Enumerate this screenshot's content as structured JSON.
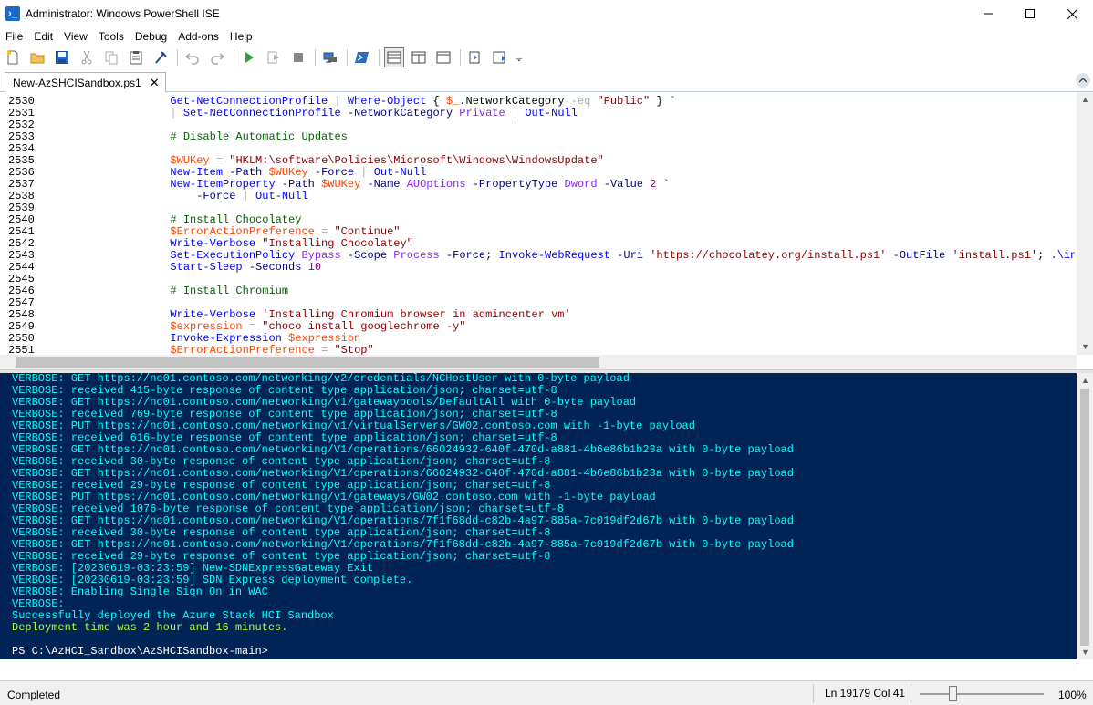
{
  "window": {
    "title": "Administrator: Windows PowerShell ISE",
    "icon_label": "›_"
  },
  "menu": [
    "File",
    "Edit",
    "View",
    "Tools",
    "Debug",
    "Add-ons",
    "Help"
  ],
  "toolbar_icons": [
    "new-icon",
    "open-icon",
    "save-icon",
    "cut-icon",
    "copy-icon",
    "paste-icon",
    "clear-console-icon",
    "undo-icon",
    "redo-icon",
    "run-script-icon",
    "run-selection-icon",
    "stop-icon",
    "remote-powershell-icon",
    "powershell-icon",
    "show-script-pane-top-icon",
    "show-script-pane-right-icon",
    "show-script-pane-maximized-icon",
    "show-script-pane-icon",
    "show-command-window-icon",
    "customize-icon"
  ],
  "tab": {
    "title": "New-AzSHCISandbox.ps1",
    "close": "✕"
  },
  "editor": {
    "line_numbers": [
      "2530",
      "2531",
      "2532",
      "2533",
      "2534",
      "2535",
      "2536",
      "2537",
      "2538",
      "2539",
      "2540",
      "2541",
      "2542",
      "2543",
      "2544",
      "2545",
      "2546",
      "2547",
      "2548",
      "2549",
      "2550",
      "2551"
    ],
    "lines": [
      [
        {
          "t": "            "
        },
        {
          "t": "Get-NetConnectionProfile",
          "c": "cmd"
        },
        {
          "t": " "
        },
        {
          "t": "|",
          "c": "op"
        },
        {
          "t": " "
        },
        {
          "t": "Where-Object",
          "c": "cmd"
        },
        {
          "t": " { "
        },
        {
          "t": "$_",
          "c": "var"
        },
        {
          "t": ".NetworkCategory "
        },
        {
          "t": "-eq",
          "c": "op"
        },
        {
          "t": " "
        },
        {
          "t": "\"Public\"",
          "c": "str"
        },
        {
          "t": " } `"
        }
      ],
      [
        {
          "t": "            "
        },
        {
          "t": "|",
          "c": "op"
        },
        {
          "t": " "
        },
        {
          "t": "Set-NetConnectionProfile",
          "c": "cmd"
        },
        {
          "t": " "
        },
        {
          "t": "-NetworkCategory",
          "c": "param"
        },
        {
          "t": " "
        },
        {
          "t": "Private",
          "c": "type"
        },
        {
          "t": " "
        },
        {
          "t": "|",
          "c": "op"
        },
        {
          "t": " "
        },
        {
          "t": "Out-Null",
          "c": "cmd"
        }
      ],
      [
        {
          "t": ""
        }
      ],
      [
        {
          "t": "            "
        },
        {
          "t": "# Disable Automatic Updates",
          "c": "com"
        }
      ],
      [
        {
          "t": ""
        }
      ],
      [
        {
          "t": "            "
        },
        {
          "t": "$WUKey",
          "c": "var"
        },
        {
          "t": " "
        },
        {
          "t": "=",
          "c": "op"
        },
        {
          "t": " "
        },
        {
          "t": "\"HKLM:\\software\\Policies\\Microsoft\\Windows\\WindowsUpdate\"",
          "c": "str"
        }
      ],
      [
        {
          "t": "            "
        },
        {
          "t": "New-Item",
          "c": "cmd"
        },
        {
          "t": " "
        },
        {
          "t": "-Path",
          "c": "param"
        },
        {
          "t": " "
        },
        {
          "t": "$WUKey",
          "c": "var"
        },
        {
          "t": " "
        },
        {
          "t": "-Force",
          "c": "param"
        },
        {
          "t": " "
        },
        {
          "t": "|",
          "c": "op"
        },
        {
          "t": " "
        },
        {
          "t": "Out-Null",
          "c": "cmd"
        }
      ],
      [
        {
          "t": "            "
        },
        {
          "t": "New-ItemProperty",
          "c": "cmd"
        },
        {
          "t": " "
        },
        {
          "t": "-Path",
          "c": "param"
        },
        {
          "t": " "
        },
        {
          "t": "$WUKey",
          "c": "var"
        },
        {
          "t": " "
        },
        {
          "t": "-Name",
          "c": "param"
        },
        {
          "t": " "
        },
        {
          "t": "AUOptions",
          "c": "type"
        },
        {
          "t": " "
        },
        {
          "t": "-PropertyType",
          "c": "param"
        },
        {
          "t": " "
        },
        {
          "t": "Dword",
          "c": "type"
        },
        {
          "t": " "
        },
        {
          "t": "-Value",
          "c": "param"
        },
        {
          "t": " "
        },
        {
          "t": "2",
          "c": "num"
        },
        {
          "t": " `"
        }
      ],
      [
        {
          "t": "                "
        },
        {
          "t": "-Force",
          "c": "param"
        },
        {
          "t": " "
        },
        {
          "t": "|",
          "c": "op"
        },
        {
          "t": " "
        },
        {
          "t": "Out-Null",
          "c": "cmd"
        }
      ],
      [
        {
          "t": ""
        }
      ],
      [
        {
          "t": "            "
        },
        {
          "t": "# Install Chocolatey",
          "c": "com"
        }
      ],
      [
        {
          "t": "            "
        },
        {
          "t": "$ErrorActionPreference",
          "c": "var"
        },
        {
          "t": " "
        },
        {
          "t": "=",
          "c": "op"
        },
        {
          "t": " "
        },
        {
          "t": "\"Continue\"",
          "c": "str"
        }
      ],
      [
        {
          "t": "            "
        },
        {
          "t": "Write-Verbose",
          "c": "cmd"
        },
        {
          "t": " "
        },
        {
          "t": "\"Installing Chocolatey\"",
          "c": "str"
        }
      ],
      [
        {
          "t": "            "
        },
        {
          "t": "Set-ExecutionPolicy",
          "c": "cmd"
        },
        {
          "t": " "
        },
        {
          "t": "Bypass",
          "c": "type"
        },
        {
          "t": " "
        },
        {
          "t": "-Scope",
          "c": "param"
        },
        {
          "t": " "
        },
        {
          "t": "Process",
          "c": "type"
        },
        {
          "t": " "
        },
        {
          "t": "-Force",
          "c": "param"
        },
        {
          "t": "; "
        },
        {
          "t": "Invoke-WebRequest",
          "c": "cmd"
        },
        {
          "t": " "
        },
        {
          "t": "-Uri",
          "c": "param"
        },
        {
          "t": " "
        },
        {
          "t": "'https://chocolatey.org/install.ps1'",
          "c": "str"
        },
        {
          "t": " "
        },
        {
          "t": "-OutFile",
          "c": "param"
        },
        {
          "t": " "
        },
        {
          "t": "'install.ps1'",
          "c": "str"
        },
        {
          "t": "; "
        },
        {
          "t": ".\\install",
          "c": "cmd"
        }
      ],
      [
        {
          "t": "            "
        },
        {
          "t": "Start-Sleep",
          "c": "cmd"
        },
        {
          "t": " "
        },
        {
          "t": "-Seconds",
          "c": "param"
        },
        {
          "t": " "
        },
        {
          "t": "10",
          "c": "num"
        }
      ],
      [
        {
          "t": ""
        }
      ],
      [
        {
          "t": "            "
        },
        {
          "t": "# Install Chromium",
          "c": "com"
        }
      ],
      [
        {
          "t": ""
        }
      ],
      [
        {
          "t": "            "
        },
        {
          "t": "Write-Verbose",
          "c": "cmd"
        },
        {
          "t": " "
        },
        {
          "t": "'Installing Chromium browser in admincenter vm'",
          "c": "str"
        }
      ],
      [
        {
          "t": "            "
        },
        {
          "t": "$expression",
          "c": "var"
        },
        {
          "t": " "
        },
        {
          "t": "=",
          "c": "op"
        },
        {
          "t": " "
        },
        {
          "t": "\"choco install googlechrome -y\"",
          "c": "str"
        }
      ],
      [
        {
          "t": "            "
        },
        {
          "t": "Invoke-Expression",
          "c": "cmd"
        },
        {
          "t": " "
        },
        {
          "t": "$expression",
          "c": "var"
        }
      ],
      [
        {
          "t": "            "
        },
        {
          "t": "$ErrorActionPreference",
          "c": "var"
        },
        {
          "t": " "
        },
        {
          "t": "=",
          "c": "op"
        },
        {
          "t": " "
        },
        {
          "t": "\"Stop\"",
          "c": "str"
        }
      ]
    ]
  },
  "console": {
    "lines": [
      {
        "text": "VERBOSE: GET https://nc01.contoso.com/networking/v2/credentials/NCHostUser with 0-byte payload",
        "color": "#00ffff"
      },
      {
        "text": "VERBOSE: received 415-byte response of content type application/json; charset=utf-8",
        "color": "#00ffff"
      },
      {
        "text": "VERBOSE: GET https://nc01.contoso.com/networking/v1/gatewaypools/DefaultAll with 0-byte payload",
        "color": "#00ffff"
      },
      {
        "text": "VERBOSE: received 769-byte response of content type application/json; charset=utf-8",
        "color": "#00ffff"
      },
      {
        "text": "VERBOSE: PUT https://nc01.contoso.com/networking/v1/virtualServers/GW02.contoso.com with -1-byte payload",
        "color": "#00ffff"
      },
      {
        "text": "VERBOSE: received 616-byte response of content type application/json; charset=utf-8",
        "color": "#00ffff"
      },
      {
        "text": "VERBOSE: GET https://nc01.contoso.com/networking/V1/operations/66024932-640f-470d-a881-4b6e86b1b23a with 0-byte payload",
        "color": "#00ffff"
      },
      {
        "text": "VERBOSE: received 30-byte response of content type application/json; charset=utf-8",
        "color": "#00ffff"
      },
      {
        "text": "VERBOSE: GET https://nc01.contoso.com/networking/V1/operations/66024932-640f-470d-a881-4b6e86b1b23a with 0-byte payload",
        "color": "#00ffff"
      },
      {
        "text": "VERBOSE: received 29-byte response of content type application/json; charset=utf-8",
        "color": "#00ffff"
      },
      {
        "text": "VERBOSE: PUT https://nc01.contoso.com/networking/v1/gateways/GW02.contoso.com with -1-byte payload",
        "color": "#00ffff"
      },
      {
        "text": "VERBOSE: received 1076-byte response of content type application/json; charset=utf-8",
        "color": "#00ffff"
      },
      {
        "text": "VERBOSE: GET https://nc01.contoso.com/networking/V1/operations/7f1f68dd-c82b-4a97-885a-7c019df2d67b with 0-byte payload",
        "color": "#00ffff"
      },
      {
        "text": "VERBOSE: received 30-byte response of content type application/json; charset=utf-8",
        "color": "#00ffff"
      },
      {
        "text": "VERBOSE: GET https://nc01.contoso.com/networking/V1/operations/7f1f68dd-c82b-4a97-885a-7c019df2d67b with 0-byte payload",
        "color": "#00ffff"
      },
      {
        "text": "VERBOSE: received 29-byte response of content type application/json; charset=utf-8",
        "color": "#00ffff"
      },
      {
        "text": "VERBOSE: [20230619-03:23:59] New-SDNExpressGateway Exit",
        "color": "#00ffff"
      },
      {
        "text": "VERBOSE: [20230619-03:23:59] SDN Express deployment complete.",
        "color": "#00ffff"
      },
      {
        "text": "VERBOSE: Enabling Single Sign On in WAC",
        "color": "#00ffff"
      },
      {
        "text": "VERBOSE:",
        "color": "#00ffff"
      },
      {
        "text": "Successfully deployed the Azure Stack HCI Sandbox",
        "color": "#00ffff"
      },
      {
        "text": "Deployment time was 2 hour and 16 minutes.",
        "color": "#adff2f"
      },
      {
        "text": "",
        "color": "#ffffff"
      },
      {
        "text": "PS C:\\AzHCI_Sandbox\\AzSHCISandbox-main>",
        "color": "#ffffff"
      }
    ]
  },
  "status": {
    "state": "Completed",
    "position": "Ln 19179  Col 41",
    "zoom": "100%",
    "zoom_level": 0.25
  },
  "colors": {
    "console_bg": "#012456",
    "verbose": "#00ffff",
    "success": "#adff2f"
  }
}
